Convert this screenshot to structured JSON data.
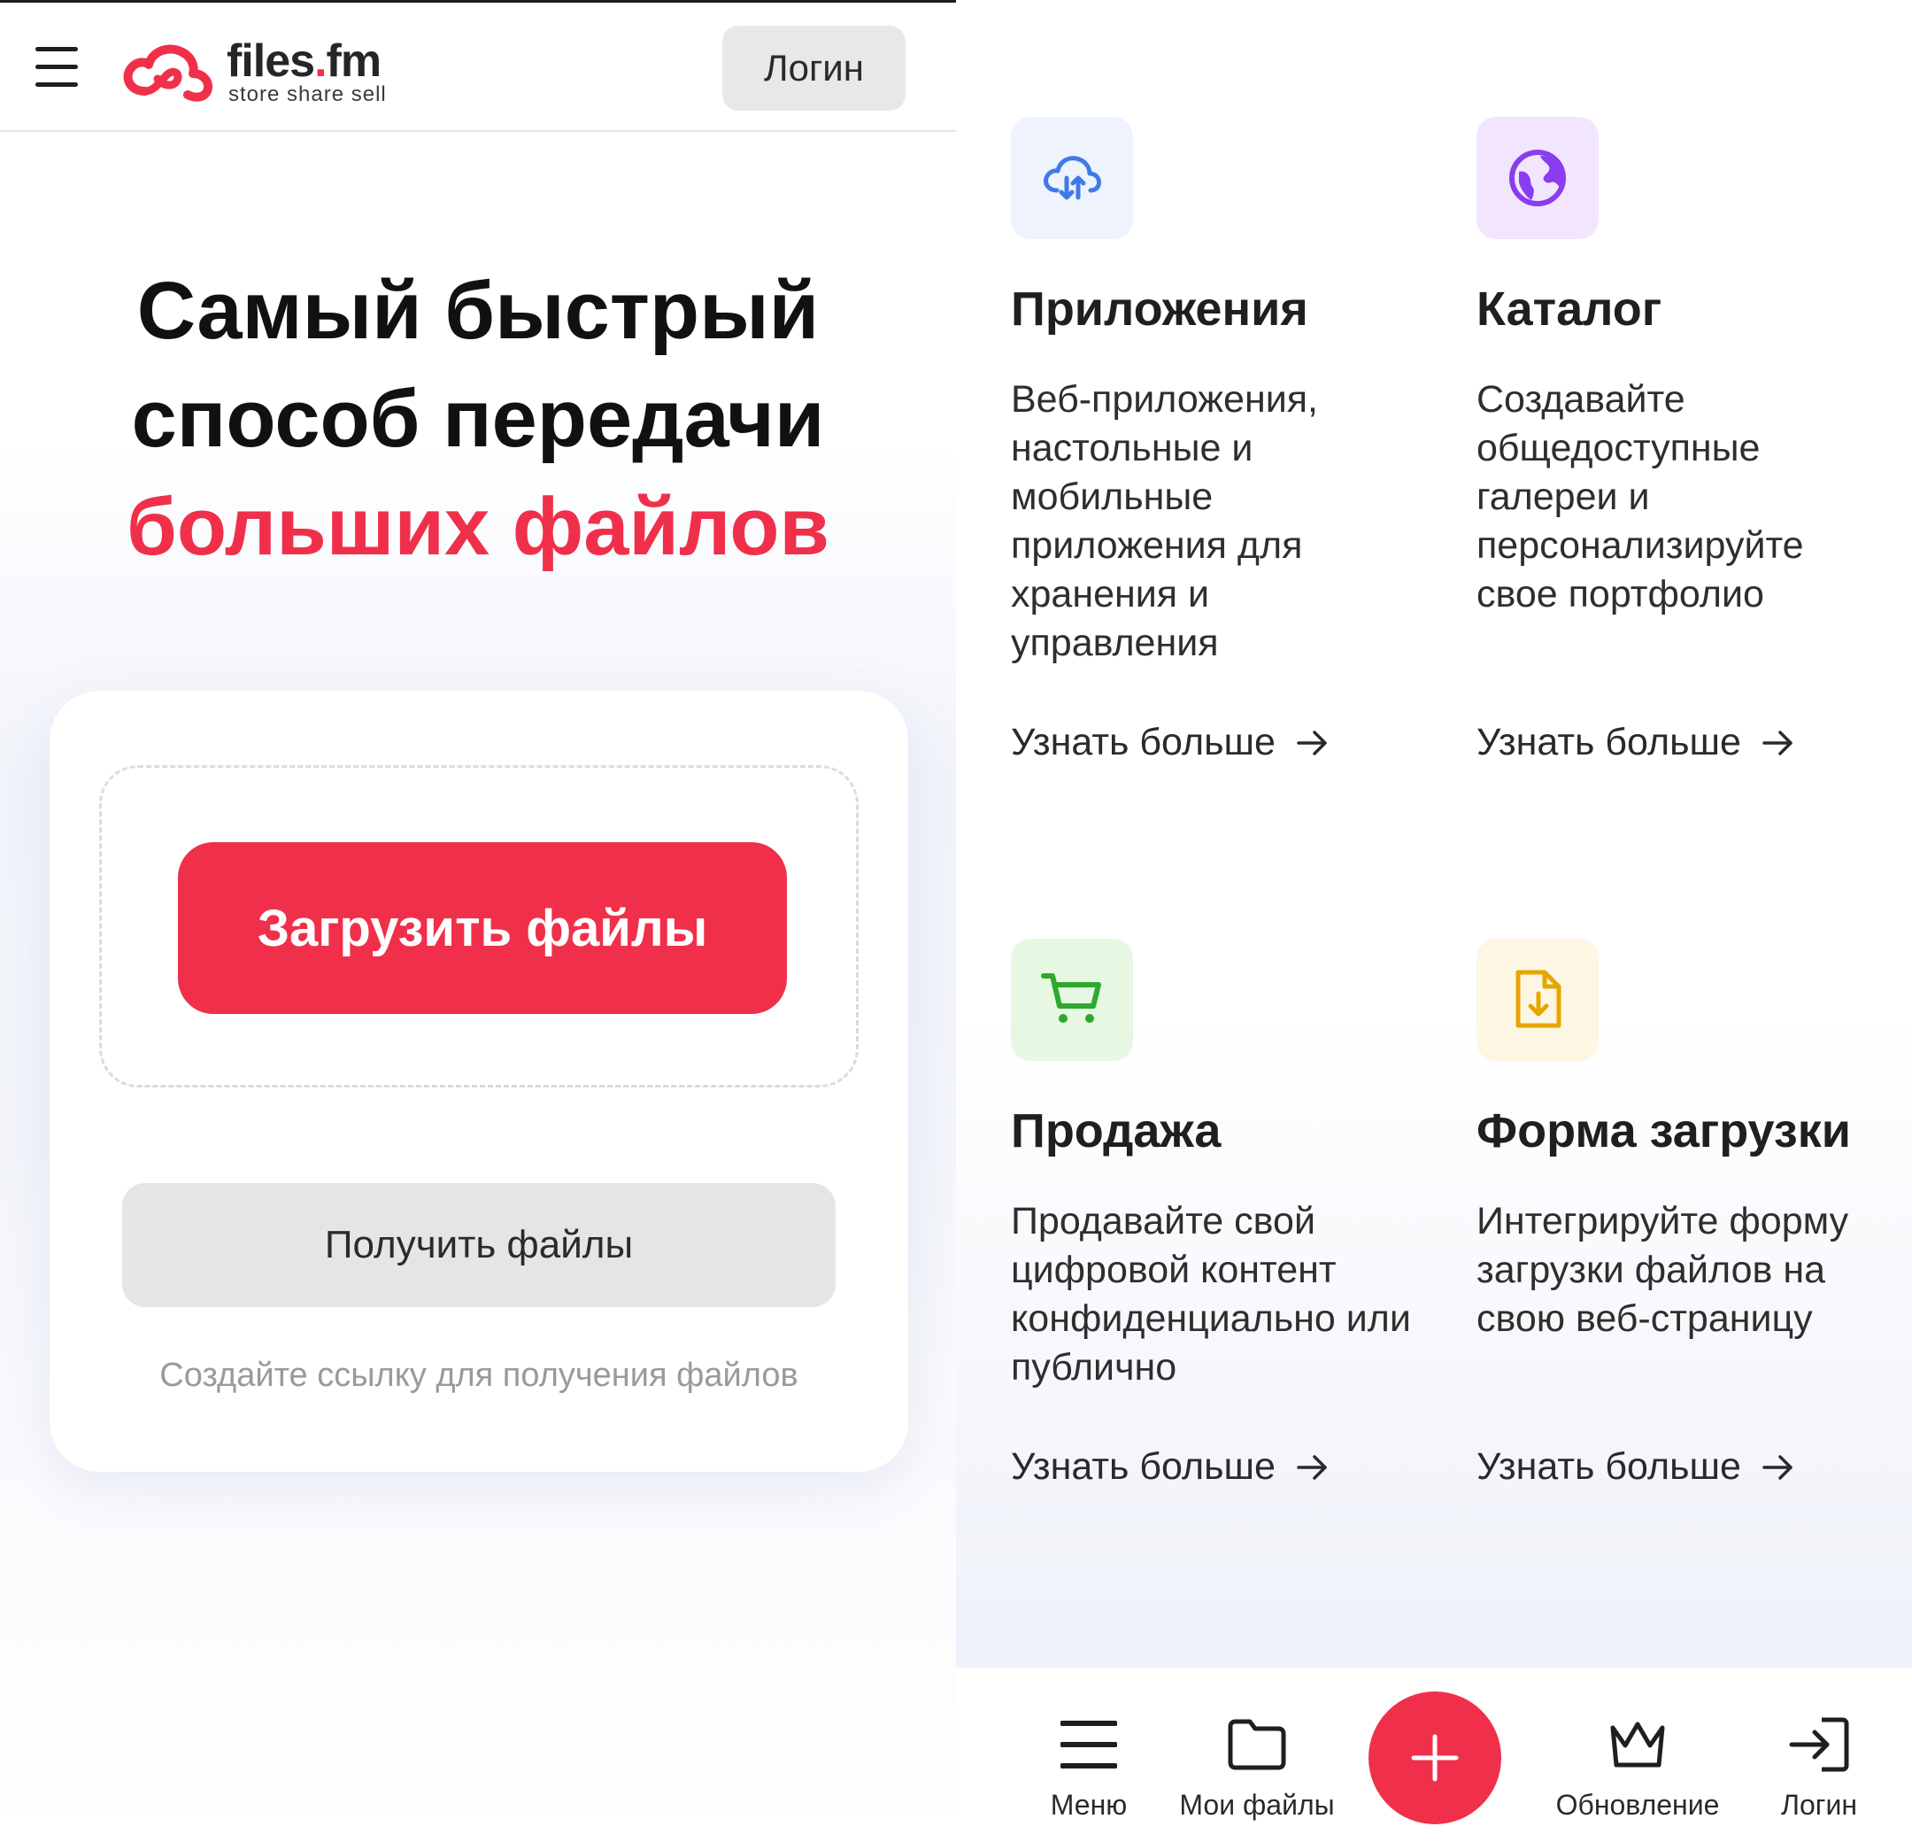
{
  "header": {
    "logo_name": "files",
    "logo_dot": ".",
    "logo_tld": "fm",
    "logo_tagline": "store  share  sell",
    "login_label": "Логин"
  },
  "hero": {
    "line1": "Самый быстрый",
    "line2": "способ передачи",
    "line3_accent": "больших файлов"
  },
  "upload": {
    "upload_label": "Загрузить файлы",
    "receive_label": "Получить файлы",
    "receive_hint": "Создайте ссылку для получения файлов"
  },
  "features": [
    {
      "icon": "cloud-sync-icon",
      "title": "Приложения",
      "desc": "Веб-приложения, настольные и мобильные приложения для хранения и управления",
      "more": "Узнать больше"
    },
    {
      "icon": "globe-icon",
      "title": "Каталог",
      "desc": "Создавайте общедоступные галереи и персонализируйте свое портфолио",
      "more": "Узнать больше"
    },
    {
      "icon": "cart-icon",
      "title": "Продажа",
      "desc": "Продавайте свой цифровой контент конфиденциально или публично",
      "more": "Узнать больше"
    },
    {
      "icon": "file-download-icon",
      "title": "Форма загрузки",
      "desc": "Интегрируйте форму загрузки файлов на свою веб-страницу",
      "more": "Узнать больше"
    }
  ],
  "bottom_nav": {
    "menu": "Меню",
    "my_files": "Мои файлы",
    "upgrade": "Обновление",
    "login": "Логин"
  },
  "colors": {
    "accent": "#f0304a",
    "apps_bg": "#eef3fd",
    "catalog_bg": "#f1e6fd",
    "sale_bg": "#e6f8e1",
    "form_bg": "#fdf6e3"
  }
}
